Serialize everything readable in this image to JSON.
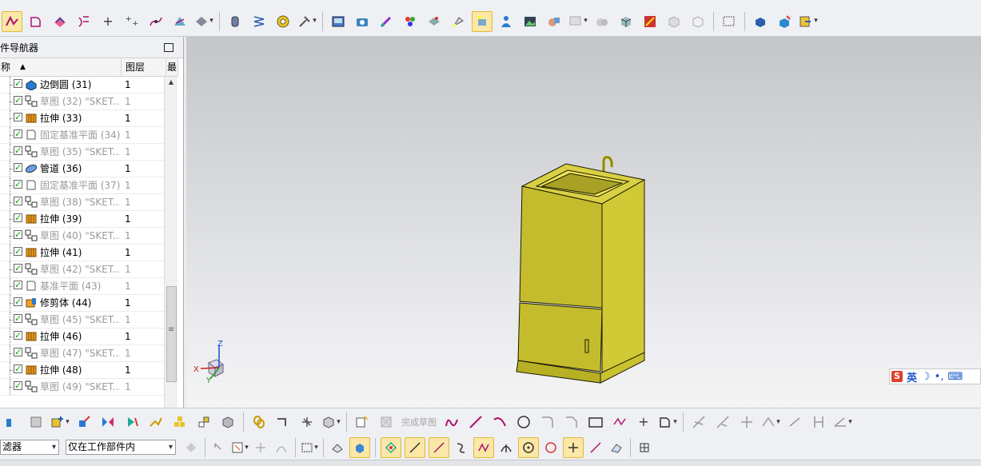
{
  "navigator": {
    "title": "部件导航器",
    "columns": {
      "name": "名称",
      "layer": "图层",
      "third": "最新"
    },
    "rows": [
      {
        "name": "边倒圆 (31)",
        "layer": "1",
        "icon": "blend-icon",
        "dim": false
      },
      {
        "name": "草图 (32) \"SKET...",
        "layer": "1",
        "icon": "sketch-icon",
        "dim": true
      },
      {
        "name": "拉伸 (33)",
        "layer": "1",
        "icon": "extrude-icon",
        "dim": false
      },
      {
        "name": "固定基准平面 (34)",
        "layer": "1",
        "icon": "datum-plane-icon",
        "dim": true
      },
      {
        "name": "草图 (35) \"SKET...",
        "layer": "1",
        "icon": "sketch-icon",
        "dim": true
      },
      {
        "name": "管道 (36)",
        "layer": "1",
        "icon": "tube-icon",
        "dim": false
      },
      {
        "name": "固定基准平面 (37)",
        "layer": "1",
        "icon": "datum-plane-icon",
        "dim": true
      },
      {
        "name": "草图 (38) \"SKET...",
        "layer": "1",
        "icon": "sketch-icon",
        "dim": true
      },
      {
        "name": "拉伸 (39)",
        "layer": "1",
        "icon": "extrude-icon",
        "dim": false
      },
      {
        "name": "草图 (40) \"SKET...",
        "layer": "1",
        "icon": "sketch-icon",
        "dim": true
      },
      {
        "name": "拉伸 (41)",
        "layer": "1",
        "icon": "extrude-icon",
        "dim": false
      },
      {
        "name": "草图 (42) \"SKET...",
        "layer": "1",
        "icon": "sketch-icon",
        "dim": true
      },
      {
        "name": "基准平面 (43)",
        "layer": "1",
        "icon": "datum-plane-icon",
        "dim": true
      },
      {
        "name": "修剪体 (44)",
        "layer": "1",
        "icon": "trim-body-icon",
        "dim": false
      },
      {
        "name": "草图 (45) \"SKET...",
        "layer": "1",
        "icon": "sketch-icon",
        "dim": true
      },
      {
        "name": "拉伸 (46)",
        "layer": "1",
        "icon": "extrude-icon",
        "dim": false
      },
      {
        "name": "草图 (47) \"SKET...",
        "layer": "1",
        "icon": "sketch-icon",
        "dim": true
      },
      {
        "name": "拉伸 (48)",
        "layer": "1",
        "icon": "extrude-icon",
        "dim": false
      },
      {
        "name": "草图 (49) \"SKET...",
        "layer": "1",
        "icon": "sketch-icon",
        "dim": true
      }
    ]
  },
  "filter_bar": {
    "type_filter": "滤器",
    "scope_filter": "仅在工作部件内"
  },
  "sketch_toolbar": {
    "finish_sketch": "完成草图"
  },
  "ime": {
    "logo": "S",
    "mode": "英",
    "moon": "☽",
    "punct": "•,",
    "keyboard": "⌨"
  },
  "triad": {
    "x": "X",
    "y": "Y",
    "z": "Z"
  },
  "colors": {
    "model_fill": "#c4bc2c",
    "model_edge": "#1a1a00",
    "highlight": "#fbe7a6"
  }
}
